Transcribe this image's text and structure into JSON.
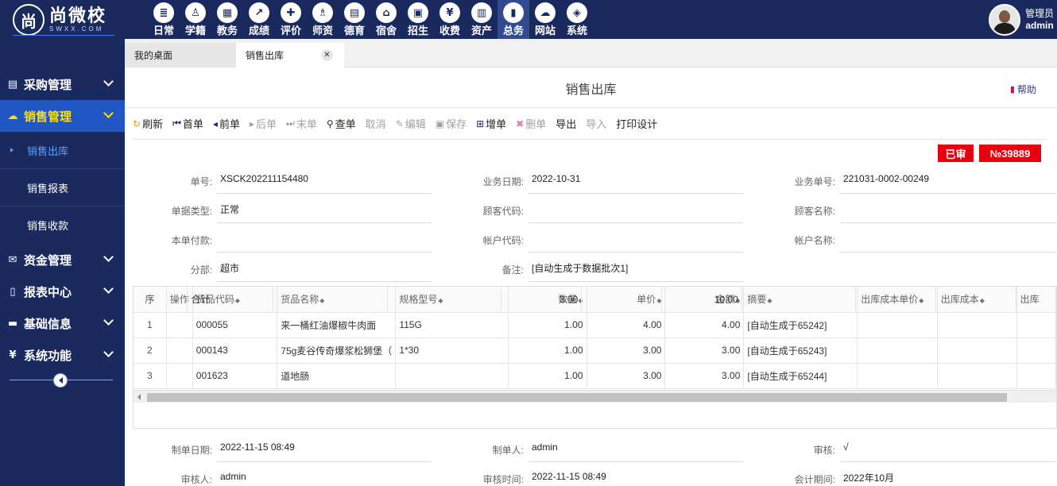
{
  "brand": {
    "name": "尚微校",
    "sub": "SWXX.COM",
    "mark": "尚"
  },
  "modules": [
    {
      "label": "日常",
      "icon": "doc-icon",
      "glyph": "≣",
      "active": false
    },
    {
      "label": "学籍",
      "icon": "student-icon",
      "glyph": "♙",
      "active": false
    },
    {
      "label": "教务",
      "icon": "calendar-icon",
      "glyph": "▦",
      "active": false
    },
    {
      "label": "成绩",
      "icon": "line-chart-icon",
      "glyph": "↗",
      "active": false
    },
    {
      "label": "评价",
      "icon": "calendar-plus-icon",
      "glyph": "✚",
      "active": false
    },
    {
      "label": "师资",
      "icon": "teacher-icon",
      "glyph": "♗",
      "active": false
    },
    {
      "label": "德育",
      "icon": "book-icon",
      "glyph": "▤",
      "active": false
    },
    {
      "label": "宿舍",
      "icon": "home-icon",
      "glyph": "⌂",
      "active": false
    },
    {
      "label": "招生",
      "icon": "bus-icon",
      "glyph": "▣",
      "active": false
    },
    {
      "label": "收费",
      "icon": "yen-icon",
      "glyph": "¥",
      "active": false
    },
    {
      "label": "资产",
      "icon": "train-icon",
      "glyph": "▥",
      "active": false
    },
    {
      "label": "总务",
      "icon": "bar-chart-icon",
      "glyph": "▮",
      "active": true
    },
    {
      "label": "网站",
      "icon": "cloud-icon",
      "glyph": "☁",
      "active": false
    },
    {
      "label": "系统",
      "icon": "cube-icon",
      "glyph": "◈",
      "active": false
    }
  ],
  "user": {
    "role": "管理员",
    "name": "admin"
  },
  "sidebar": {
    "groups": [
      {
        "label": "采购管理",
        "icon": "book-icon",
        "glyph": "▤"
      },
      {
        "label": "销售管理",
        "icon": "cloud-icon",
        "glyph": "☁"
      },
      {
        "label": "资金管理",
        "icon": "envelope-icon",
        "glyph": "✉"
      },
      {
        "label": "报表中心",
        "icon": "file-icon",
        "glyph": "▯"
      },
      {
        "label": "基础信息",
        "icon": "folder-icon",
        "glyph": "▬"
      },
      {
        "label": "系统功能",
        "icon": "yen-box-icon",
        "glyph": "¥"
      }
    ],
    "subitems": [
      {
        "label": "销售出库"
      },
      {
        "label": "销售报表"
      },
      {
        "label": "销售收款"
      }
    ]
  },
  "tabs": [
    {
      "label": "我的桌面"
    },
    {
      "label": "销售出库"
    }
  ],
  "page": {
    "title": "销售出库",
    "help": "帮助"
  },
  "toolbar": [
    {
      "label": "刷新",
      "icon": "refresh-icon",
      "glyph": "↻",
      "cls": "orange",
      "disabled": false
    },
    {
      "label": "首单",
      "icon": "first-icon",
      "glyph": "⏮",
      "cls": "navy",
      "disabled": false
    },
    {
      "label": "前单",
      "icon": "prev-icon",
      "glyph": "◂",
      "cls": "navy",
      "disabled": false
    },
    {
      "label": "后单",
      "icon": "next-icon",
      "glyph": "▸",
      "cls": "",
      "disabled": true
    },
    {
      "label": "末单",
      "icon": "last-icon",
      "glyph": "⏭",
      "cls": "",
      "disabled": true
    },
    {
      "label": "查单",
      "icon": "search-icon",
      "glyph": "⚲",
      "cls": "navy",
      "disabled": false
    },
    {
      "label": "取消",
      "icon": "",
      "glyph": "",
      "cls": "",
      "disabled": true
    },
    {
      "label": "编辑",
      "icon": "edit-icon",
      "glyph": "✎",
      "cls": "",
      "disabled": true
    },
    {
      "label": "保存",
      "icon": "save-icon",
      "glyph": "▣",
      "cls": "",
      "disabled": true
    },
    {
      "label": "增单",
      "icon": "plus-box-icon",
      "glyph": "⊞",
      "cls": "navy",
      "disabled": false
    },
    {
      "label": "删单",
      "icon": "times-icon",
      "glyph": "✖",
      "cls": "pink",
      "disabled": true
    },
    {
      "label": "导出",
      "icon": "",
      "glyph": "",
      "cls": "",
      "disabled": false
    },
    {
      "label": "导入",
      "icon": "",
      "glyph": "",
      "cls": "",
      "disabled": true
    },
    {
      "label": "打印设计",
      "icon": "",
      "glyph": "",
      "cls": "",
      "disabled": false
    }
  ],
  "status": {
    "approved": "已审",
    "number": "№39889"
  },
  "form": {
    "rows": [
      [
        {
          "label": "单号:",
          "value": "XSCK202211154480"
        },
        {
          "label": "业务日期:",
          "value": "2022-10-31"
        },
        {
          "label": "业务单号:",
          "value": "221031-0002-00249"
        }
      ],
      [
        {
          "label": "单据类型:",
          "value": "正常"
        },
        {
          "label": "顾客代码:",
          "value": ""
        },
        {
          "label": "顾客名称:",
          "value": ""
        }
      ],
      [
        {
          "label": "本单付款:",
          "value": ""
        },
        {
          "label": "帐户代码:",
          "value": ""
        },
        {
          "label": "帐户名称:",
          "value": ""
        }
      ],
      [
        {
          "label": "分部:",
          "value": "超市"
        },
        {
          "label": "备注:",
          "value": "[自动生成于数据批次1]"
        }
      ]
    ]
  },
  "grid": {
    "columns": [
      "序",
      "操作",
      "货品代码",
      "货品名称",
      "规格型号",
      "数量",
      "单价",
      "金额",
      "摘要",
      "出库成本单价",
      "出库成本",
      "出库"
    ],
    "rows": [
      [
        "1",
        "",
        "000055",
        "来一桶红油爆椒牛肉面",
        "115G",
        "1.00",
        "4.00",
        "4.00",
        "[自动生成于65242]",
        "",
        "",
        ""
      ],
      [
        "2",
        "",
        "000143",
        "75g麦谷传奇爆浆松狮堡（",
        "1*30",
        "1.00",
        "3.00",
        "3.00",
        "[自动生成于65243]",
        "",
        "",
        ""
      ],
      [
        "3",
        "",
        "001623",
        "道地肠",
        "",
        "1.00",
        "3.00",
        "3.00",
        "[自动生成于65244]",
        "",
        "",
        ""
      ]
    ],
    "summary": {
      "label": "合计",
      "qty": "3.00",
      "amount": "10.00"
    }
  },
  "footer": {
    "rows": [
      [
        {
          "label": "制单日期:",
          "value": "2022-11-15 08:49"
        },
        {
          "label": "制单人:",
          "value": "admin"
        },
        {
          "label": "审核:",
          "value": "√"
        }
      ],
      [
        {
          "label": "审核人:",
          "value": "admin"
        },
        {
          "label": "审核时间:",
          "value": "2022-11-15 08:49"
        },
        {
          "label": "会计期间:",
          "value": "2022年10月"
        }
      ]
    ]
  }
}
